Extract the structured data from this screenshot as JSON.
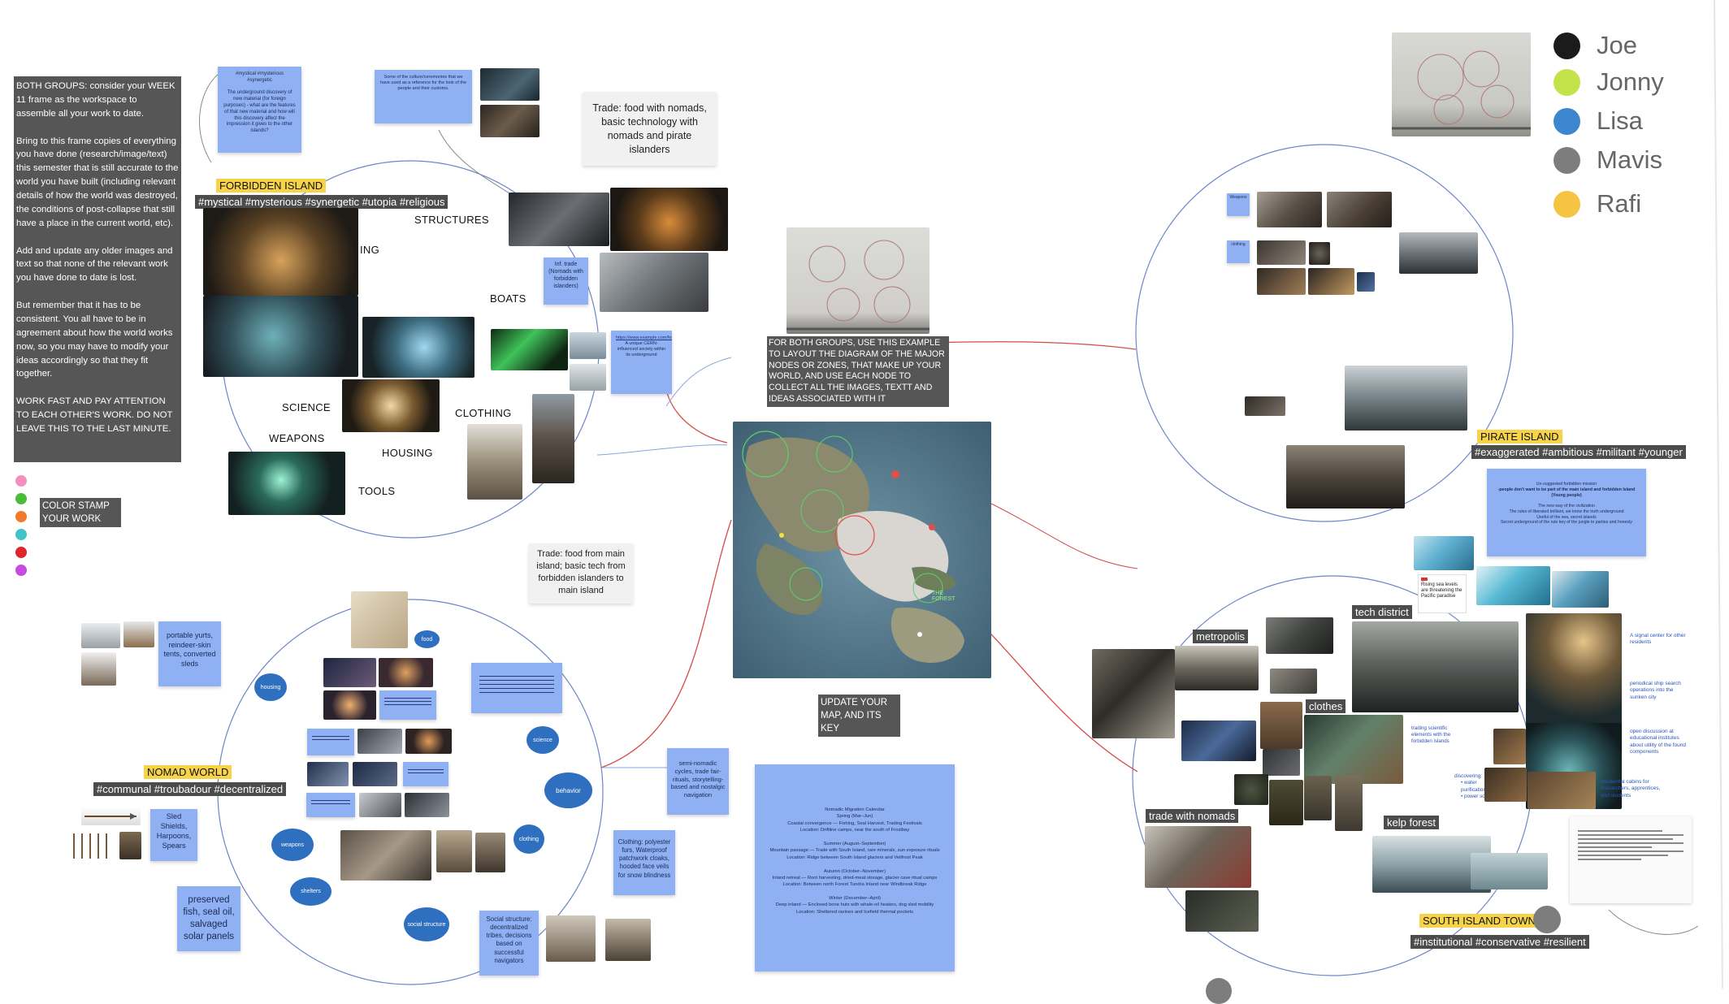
{
  "instructions": {
    "para1": "BOTH GROUPS: consider your WEEK 11 frame as the workspace to assemble all your work to date.",
    "para2": "Bring to this frame copies of everything you have done (research/image/text) this semester that is still accurate to the world you have built (including relevant details of how the world was destroyed, the conditions of post-collapse that still have a place in the current world, etc).",
    "para3": "Add and update any older images and text so that none of the relevant work you have done to date is lost.",
    "para4": "But remember that it has to be consistent. You all have to be in agreement about how the world works now, so you may have to modify your ideas accordingly so that they fit together.",
    "para5": "WORK FAST AND PAY ATTENTION TO EACH OTHER'S  WORK. DO NOT LEAVE THIS TO THE LAST MINUTE."
  },
  "color_stamp": {
    "label": "COLOR STAMP YOUR WORK",
    "colors": [
      "#f48fc0",
      "#4cbb3a",
      "#f07a2a",
      "#3fc4c9",
      "#e0262a",
      "#c44de0"
    ]
  },
  "legend": [
    {
      "name": "Joe",
      "color": "#1b1b1b"
    },
    {
      "name": "Jonny",
      "color": "#c4e24a"
    },
    {
      "name": "Lisa",
      "color": "#3b86cf"
    },
    {
      "name": "Mavis",
      "color": "#7d7d7d"
    },
    {
      "name": "Rafi",
      "color": "#f5c443"
    }
  ],
  "forbidden": {
    "title": "FORBIDDEN ISLAND",
    "tags": "#mystical #mysterious #synergetic #utopia #religious",
    "labels": {
      "structures": "STRUCTURES",
      "ing": "ING",
      "boats": "BOATS",
      "science": "SCIENCE",
      "clothing": "CLOTHING",
      "weapons": "WEAPONS",
      "housing": "HOUSING",
      "tools": "TOOLS"
    },
    "trade_main": "Trade: food with nomads, basic technology with nomads and pirate islanders",
    "inf_trade": "Inf. trade (Nomads with forbidden islanders)"
  },
  "center": {
    "instruction": "FOR BOTH GROUPS, USE THIS EXAMPLE TO LAYOUT THE DIAGRAM OF THE MAJOR NODES OR ZONES, THAT MAKE UP YOUR WORLD, AND USE EACH NODE TO COLLECT ALL THE IMAGES, TEXTT AND IDEAS ASSOCIATED WITH IT",
    "update_map": "UPDATE YOUR MAP, AND ITS KEY",
    "trade_nomad": "Trade: food from main island; basic tech from forbidden islanders to main island"
  },
  "pirate": {
    "title": "PIRATE ISLAND",
    "tags": "#exaggerated #ambitious #militant #younger"
  },
  "nomad": {
    "title": "NOMAD WORLD",
    "tags": "#communal #troubadour #decentralized",
    "portable": "portable yurts, reindeer-skin tents, converted sleds",
    "sled": "Sled Shields, Harpoons, Spears",
    "preserved": "preserved fish, seal oil, salvaged solar panels",
    "semi": "semi-nomadic cycles, trade fair-rituals, storytelling-based and nostalgic navigation",
    "clothing_note": "Clothing: polyester furs, Waterproof patchwork cloaks, hooded face veils for snow blindness",
    "social": "Social structure: decentralized tribes, decisions based on successful navigators",
    "dots": {
      "housing": "housing",
      "science": "science",
      "behavior": "behavior",
      "clothing": "clothing",
      "weapons": "weapons",
      "shelters": "shelters",
      "social": "social structure",
      "food": "food"
    }
  },
  "calendar": {
    "title": "Nomadic Migration Calendar",
    "lines": [
      "Spring (Mar–Jun)",
      "Coastal convergence — Fishing, Seal Harvest, Trading Festivals",
      "Location: Driftline camps, near the south of Frostbay",
      "",
      "Summer (August–September)",
      "Mountain passage — Trade with South Island, rare minerals, sun exposure rituals",
      "Location: Ridge between South Island glaciers and Veilfrost Peak",
      "",
      "Autumn (October–November)",
      "Inland retreat — Root harvesting, dried-meat storage, glacier cave ritual camps",
      "Location: Between north Forest Tundra Inland near Windbreak Ridge",
      "",
      "Winter (December–April)",
      "Deep inland — Enclosed bone huts with whale-oil heaters, dog sled mobility",
      "Location: Sheltered ravines and Icefield thermal pockets"
    ]
  },
  "south": {
    "title": "SOUTH ISLAND TOWN",
    "tags": "#institutional #conservative #resilient",
    "metropolis": "metropolis",
    "tech": "tech district",
    "clothes": "clothes",
    "trade": "trade with nomads",
    "kelp": "kelp forest",
    "notes": {
      "signal": "A signal center for other residents",
      "periodical": "periodical ship search operations into the sunken city",
      "open": "open discussion at educational institutes about utility of the found components",
      "trading": "trading scientific elements with the forbidden islands",
      "discovering": "discovering:",
      "water": "water purification",
      "power": "power source",
      "residential": "residential cabins for researchers, apprentices, and students"
    },
    "news": "Rising sea levels are threatening the Pacific paradise"
  },
  "pirate_note": {
    "head": "Un-suggested forbidden mission",
    "lines": [
      "-people don't want to be part of the main island and forbidden Island (Young people)",
      "The new way of the civilization",
      "The rules of liberated brilliant, we know the truth underground",
      "Useful of the sea, secret islands",
      "Secret underground of the rule key of the jungle to parties and honesty"
    ]
  },
  "map_labels": {
    "forest": "THE FOREST"
  }
}
